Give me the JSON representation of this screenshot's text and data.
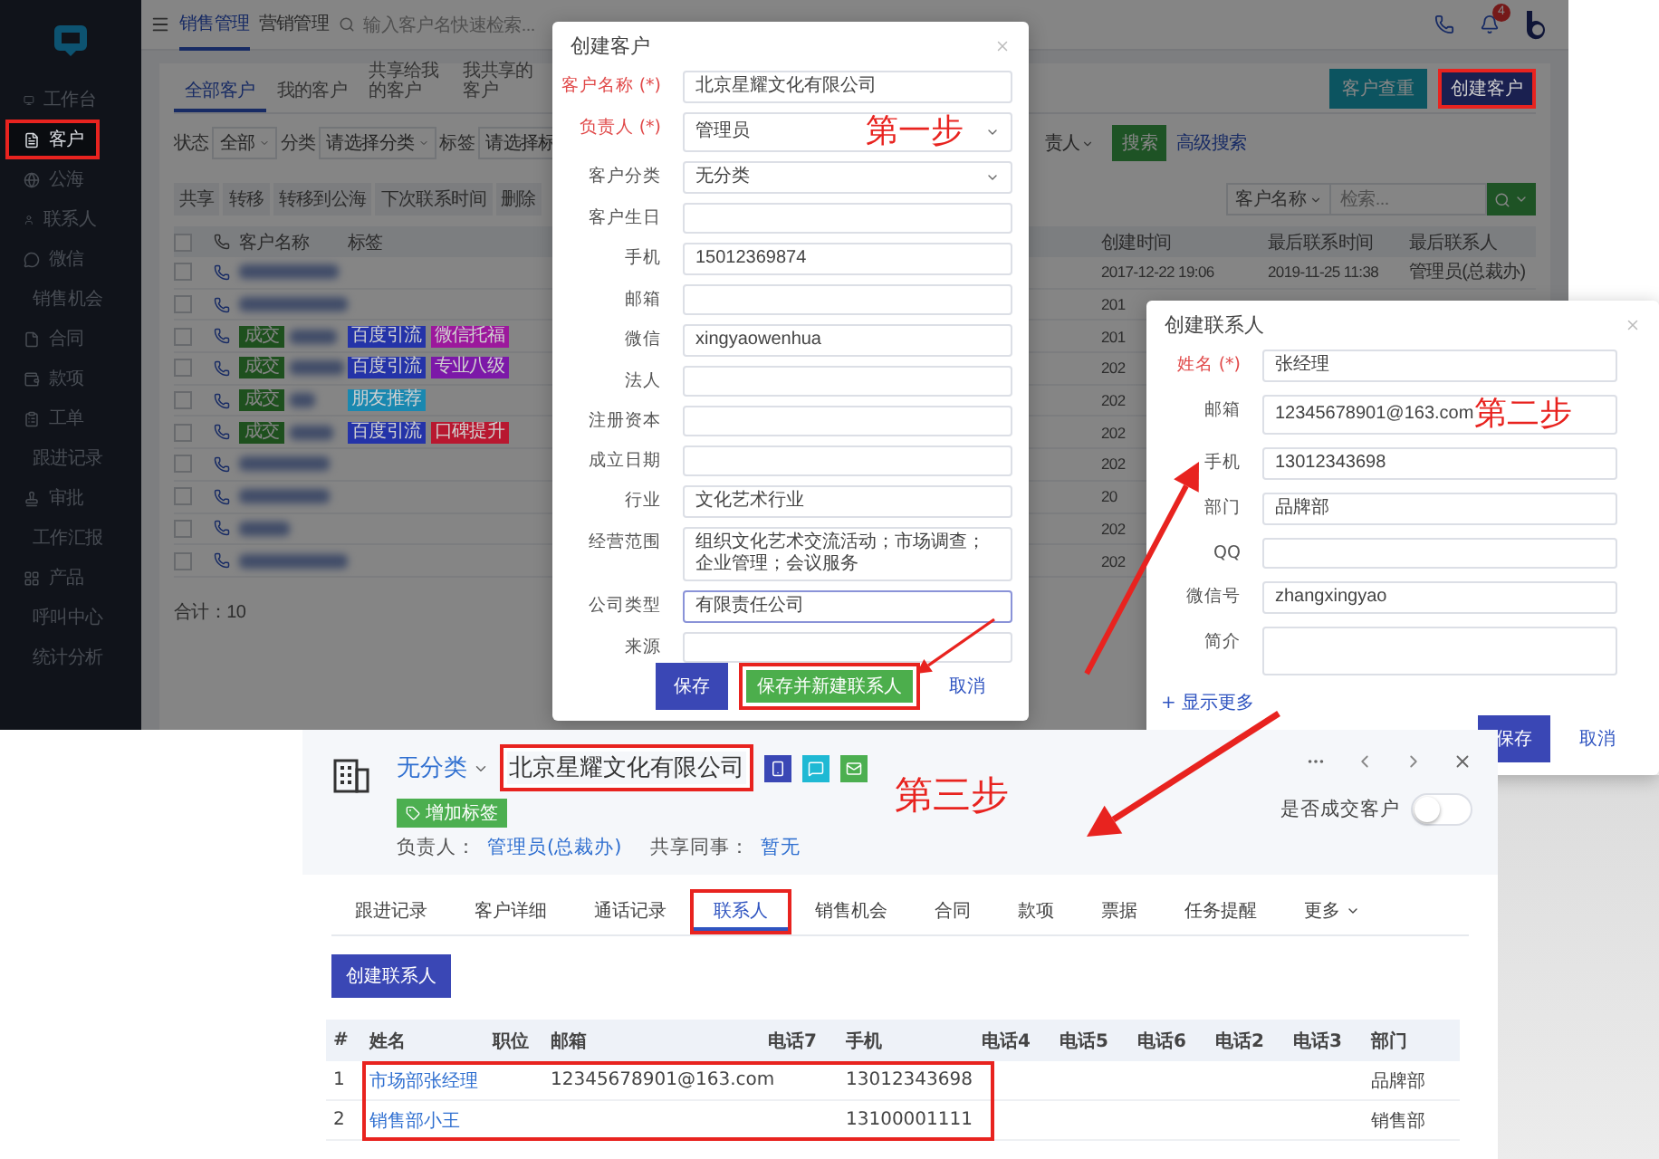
{
  "app": {
    "nav_tabs": [
      {
        "label": "销售管理",
        "selected": true
      },
      {
        "label": "营销管理",
        "selected": false
      }
    ],
    "search": {
      "placeholder": "输入客户名快速检索..."
    },
    "notification_count": "4",
    "sidebar": [
      {
        "label": "工作台",
        "selected": false,
        "highlighted": false
      },
      {
        "label": "客户",
        "selected": true,
        "highlighted": true
      },
      {
        "label": "公海",
        "selected": false,
        "highlighted": false
      },
      {
        "label": "联系人",
        "selected": false,
        "highlighted": false
      },
      {
        "label": "微信",
        "selected": false,
        "highlighted": false
      },
      {
        "label": "销售机会",
        "selected": false,
        "highlighted": false
      },
      {
        "label": "合同",
        "selected": false,
        "highlighted": false
      },
      {
        "label": "款项",
        "selected": false,
        "highlighted": false
      },
      {
        "label": "工单",
        "selected": false,
        "highlighted": false
      },
      {
        "label": "跟进记录",
        "selected": false,
        "highlighted": false
      },
      {
        "label": "审批",
        "selected": false,
        "highlighted": false
      },
      {
        "label": "工作汇报",
        "selected": false,
        "highlighted": false
      },
      {
        "label": "产品",
        "selected": false,
        "highlighted": false
      },
      {
        "label": "呼叫中心",
        "selected": false,
        "highlighted": false
      },
      {
        "label": "统计分析",
        "selected": false,
        "highlighted": false
      }
    ],
    "sub_tabs": [
      {
        "label": "全部客户",
        "selected": true
      },
      {
        "label": "我的客户",
        "selected": false
      },
      {
        "label": "共享给我的客户",
        "selected": false
      },
      {
        "label": "我共享的客户",
        "selected": false
      }
    ],
    "header_buttons": [
      {
        "label": "客户查重",
        "kind": "secondary",
        "highlighted": false
      },
      {
        "label": "创建客户",
        "kind": "primary",
        "highlighted": true
      }
    ],
    "filters": [
      {
        "label": "状态",
        "value": "全部"
      },
      {
        "label": "分类",
        "value": "请选择分类"
      },
      {
        "label": "标签",
        "value": "请选择标"
      }
    ],
    "owner_filter": "责人",
    "search_button": "搜索",
    "advanced_search": "高级搜索",
    "toolbar": [
      "共享",
      "转移",
      "转移到公海",
      "下次联系时间",
      "删除"
    ],
    "list_search": {
      "field": "客户名称",
      "placeholder": "检索..."
    },
    "select_all_checked": false,
    "columns": {
      "name": "客户名称",
      "tags": "标签",
      "created": "创建时间",
      "last_contact": "最后联系时间",
      "last_person": "最后联系人"
    },
    "rows": [
      {
        "checked": false,
        "created": "2017-12-22 19:06",
        "last_contact": "2019-11-25 11:38",
        "last_person": "管理员(总裁办)"
      },
      {
        "checked": false,
        "created": "201"
      },
      {
        "checked": false,
        "status": "成交",
        "tags": [
          {
            "label": "百度引流",
            "color": "#2433a8"
          },
          {
            "label": "微信托福",
            "color": "#9c189c"
          }
        ],
        "created": "201"
      },
      {
        "checked": false,
        "status": "成交",
        "tags": [
          {
            "label": "百度引流",
            "color": "#2433a8"
          },
          {
            "label": "专业八级",
            "color": "#7c18a8"
          }
        ],
        "created": "202"
      },
      {
        "checked": false,
        "status": "成交",
        "tags": [
          {
            "label": "朋友推荐",
            "color": "#1a88b0"
          }
        ],
        "created": "202"
      },
      {
        "checked": false,
        "status": "成交",
        "tags": [
          {
            "label": "百度引流",
            "color": "#2433a8"
          },
          {
            "label": "口碑提升",
            "color": "#b81830"
          }
        ],
        "created": "202"
      },
      {
        "checked": false,
        "created": "202"
      },
      {
        "checked": false,
        "created": "20"
      },
      {
        "checked": false,
        "created": "202"
      },
      {
        "checked": false,
        "created": "202"
      }
    ],
    "total": "合计：10"
  },
  "customer_dialog": {
    "title": "创建客户",
    "step_label": "第一步",
    "fields": [
      {
        "label": "客户名称 (*)",
        "required": true,
        "kind": "input",
        "value": "北京星耀文化有限公司",
        "focused": false
      },
      {
        "label": "负责人 (*)",
        "required": true,
        "kind": "select",
        "value": "管理员",
        "focused": false
      },
      {
        "label": "客户分类",
        "required": false,
        "kind": "select",
        "value": "无分类",
        "focused": false
      },
      {
        "label": "客户生日",
        "required": false,
        "kind": "input",
        "focused": false
      },
      {
        "label": "手机",
        "required": false,
        "kind": "input",
        "value": "15012369874",
        "focused": false
      },
      {
        "label": "邮箱",
        "required": false,
        "kind": "input",
        "focused": false
      },
      {
        "label": "微信",
        "required": false,
        "kind": "input",
        "value": "xingyaowenhua",
        "focused": false
      },
      {
        "label": "法人",
        "required": false,
        "kind": "input",
        "focused": false
      },
      {
        "label": "注册资本",
        "required": false,
        "kind": "input",
        "focused": false
      },
      {
        "label": "成立日期",
        "required": false,
        "kind": "input",
        "focused": false
      },
      {
        "label": "行业",
        "required": false,
        "kind": "input",
        "value": "文化艺术行业",
        "focused": false
      },
      {
        "label": "经营范围",
        "required": false,
        "kind": "input",
        "value": "组织文化艺术交流活动；市场调查；企业管理；会议服务",
        "focused": false
      },
      {
        "label": "公司类型",
        "required": false,
        "kind": "input",
        "value": "有限责任公司",
        "focused": true
      },
      {
        "label": "来源",
        "required": false,
        "kind": "input",
        "focused": false
      }
    ],
    "buttons": [
      {
        "label": "保存",
        "kind": "primary",
        "highlighted": false
      },
      {
        "label": "保存并新建联系人",
        "kind": "success",
        "highlighted": true
      },
      {
        "label": "取消",
        "kind": "link",
        "highlighted": false
      }
    ]
  },
  "contact_dialog": {
    "title": "创建联系人",
    "step_label": "第二步",
    "fields": [
      {
        "label": "姓名 (*)",
        "required": true,
        "kind": "input",
        "value": "张经理"
      },
      {
        "label": "邮箱",
        "required": false,
        "kind": "input",
        "value": "12345678901@163.com"
      },
      {
        "label": "手机",
        "required": false,
        "kind": "input",
        "value": "13012343698"
      },
      {
        "label": "部门",
        "required": false,
        "kind": "input",
        "value": "品牌部"
      },
      {
        "label": "QQ",
        "required": false,
        "kind": "input"
      },
      {
        "label": "微信号",
        "required": false,
        "kind": "input",
        "value": "zhangxingyao"
      },
      {
        "label": "简介",
        "required": false,
        "kind": "textarea"
      }
    ],
    "more_link": "+ 显示更多",
    "buttons": [
      {
        "label": "保存",
        "kind": "primary"
      },
      {
        "label": "取消",
        "kind": "link"
      }
    ]
  },
  "customer_detail": {
    "step_label": "第三步",
    "category": "无分类",
    "name": "北京星耀文化有限公司",
    "name_highlighted": true,
    "add_tag": "增加标签",
    "owner_label": "负责人：",
    "owner": "管理员(总裁办)",
    "shared_label": "共享同事：",
    "shared": "暂无",
    "deal_label": "是否成交客户",
    "deal": false,
    "tabs": [
      {
        "label": "跟进记录",
        "selected": false,
        "highlighted": false,
        "dropdown": false
      },
      {
        "label": "客户详细",
        "selected": false,
        "highlighted": false,
        "dropdown": false
      },
      {
        "label": "通话记录",
        "selected": false,
        "highlighted": false,
        "dropdown": false
      },
      {
        "label": "联系人",
        "selected": true,
        "highlighted": true,
        "dropdown": false
      },
      {
        "label": "销售机会",
        "selected": false,
        "highlighted": false,
        "dropdown": false
      },
      {
        "label": "合同",
        "selected": false,
        "highlighted": false,
        "dropdown": false
      },
      {
        "label": "款项",
        "selected": false,
        "highlighted": false,
        "dropdown": false
      },
      {
        "label": "票据",
        "selected": false,
        "highlighted": false,
        "dropdown": false
      },
      {
        "label": "任务提醒",
        "selected": false,
        "highlighted": false,
        "dropdown": false
      },
      {
        "label": "更多",
        "selected": false,
        "highlighted": false,
        "dropdown": true
      }
    ],
    "create_button": "创建联系人",
    "columns": [
      "#",
      "姓名",
      "职位",
      "邮箱",
      "电话7",
      "手机",
      "电话4",
      "电话5",
      "电话6",
      "电话2",
      "电话3",
      "部门"
    ],
    "rows": [
      {
        "index": "1",
        "name": "市场部张经理",
        "email": "12345678901@163.com",
        "mobile": "13012343698",
        "department": "品牌部"
      },
      {
        "index": "2",
        "name": "销售部小王",
        "mobile": "13100001111",
        "department": "销售部"
      }
    ],
    "rows_highlighted": true
  }
}
